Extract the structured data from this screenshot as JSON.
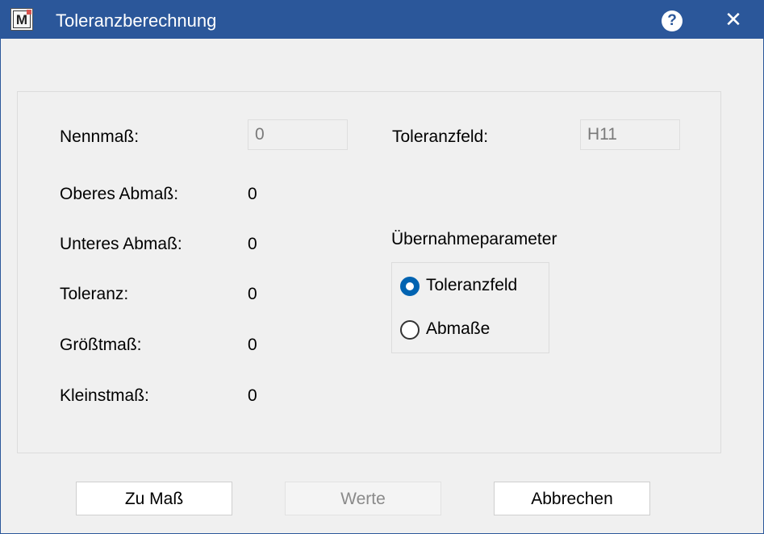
{
  "window": {
    "title": "Toleranzberechnung",
    "app_icon_letter": "M",
    "help_glyph": "?",
    "close_glyph": "✕"
  },
  "form": {
    "nennmass_label": "Nennmaß:",
    "nennmass_value": "0",
    "toleranzfeld_label": "Toleranzfeld:",
    "toleranzfeld_value": "H11",
    "oberes_label": "Oberes Abmaß:",
    "oberes_value": "0",
    "unteres_label": "Unteres Abmaß:",
    "unteres_value": "0",
    "toleranz_label": "Toleranz:",
    "toleranz_value": "0",
    "groesstmass_label": "Größtmaß:",
    "groesstmass_value": "0",
    "kleinstmass_label": "Kleinstmaß:",
    "kleinstmass_value": "0"
  },
  "uebernahme": {
    "heading": "Übernahmeparameter",
    "options": [
      {
        "label": "Toleranzfeld",
        "checked": true
      },
      {
        "label": "Abmaße",
        "checked": false
      }
    ]
  },
  "buttons": {
    "zu_mass": "Zu Maß",
    "werte": "Werte",
    "abbrechen": "Abbrechen"
  },
  "colors": {
    "titlebar": "#2b579a",
    "accent": "#0063b1",
    "background": "#f0f0f0"
  }
}
